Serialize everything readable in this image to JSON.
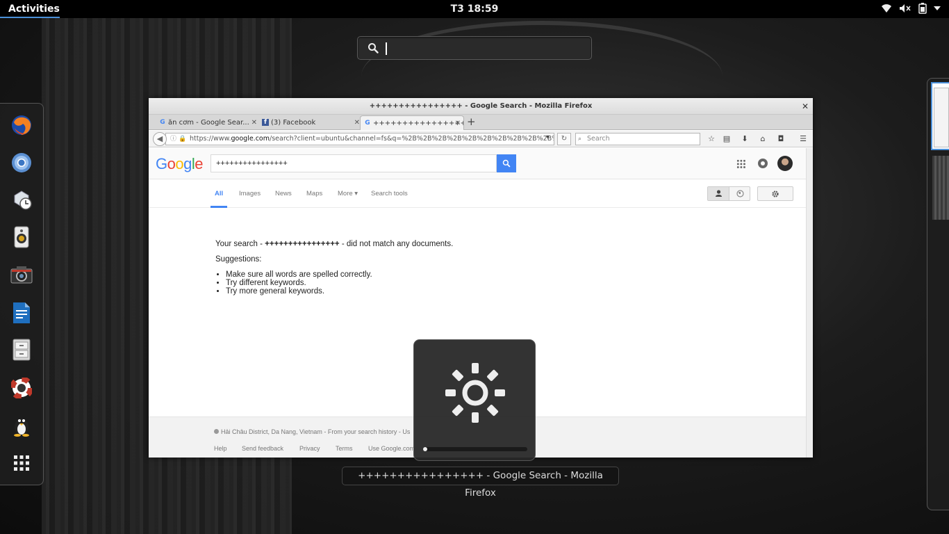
{
  "topbar": {
    "activities": "Activities",
    "clock": "T3 18:59",
    "icons": [
      "wifi-icon",
      "volume-muted-icon",
      "battery-icon",
      "chevron-down-icon"
    ]
  },
  "overview": {
    "search_placeholder": ""
  },
  "dash": {
    "apps": [
      "firefox",
      "chromium",
      "settings-clock",
      "speaker-app",
      "camera",
      "document-writer",
      "file-cabinet",
      "help-lifebuoy",
      "tux-penguin",
      "show-applications"
    ]
  },
  "firefox": {
    "window_title": "++++++++++++++++ - Google Search - Mozilla Firefox",
    "tabs": [
      {
        "label": "ăn cơm - Google Sear...",
        "favicon": "G"
      },
      {
        "label": "(3) Facebook",
        "favicon": "f"
      },
      {
        "label": "++++++++++++++++...",
        "favicon": "G"
      }
    ],
    "url_prefix": "https://www.",
    "url_host": "google.com",
    "url_rest": "/search?client=ubuntu&channel=fs&q=%2B%2B%2B%2B%2B%2B%2B%2B%2B%2B%2B%2B%",
    "search_placeholder": "Search"
  },
  "google": {
    "query": "++++++++++++++++",
    "tabs": [
      "All",
      "Images",
      "News",
      "Maps",
      "More",
      "Search tools"
    ],
    "result_prefix": "Your search - ",
    "result_query": "++++++++++++++++",
    "result_suffix": " - did not match any documents.",
    "suggestions_label": "Suggestions:",
    "suggestions": [
      "Make sure all words are spelled correctly.",
      "Try different keywords.",
      "Try more general keywords."
    ],
    "location": "Hải Châu District, Da Nang, Vietnam - From your search history - Us",
    "footer_links": [
      "Help",
      "Send feedback",
      "Privacy",
      "Terms",
      "Use Google.com"
    ]
  },
  "osd": {
    "icon": "brightness-icon",
    "level": 0.02
  },
  "caption": "++++++++++++++++ - Google Search - Mozilla Firefox",
  "colors": {
    "accent": "#4a90d9",
    "google_blue": "#4285f4"
  }
}
